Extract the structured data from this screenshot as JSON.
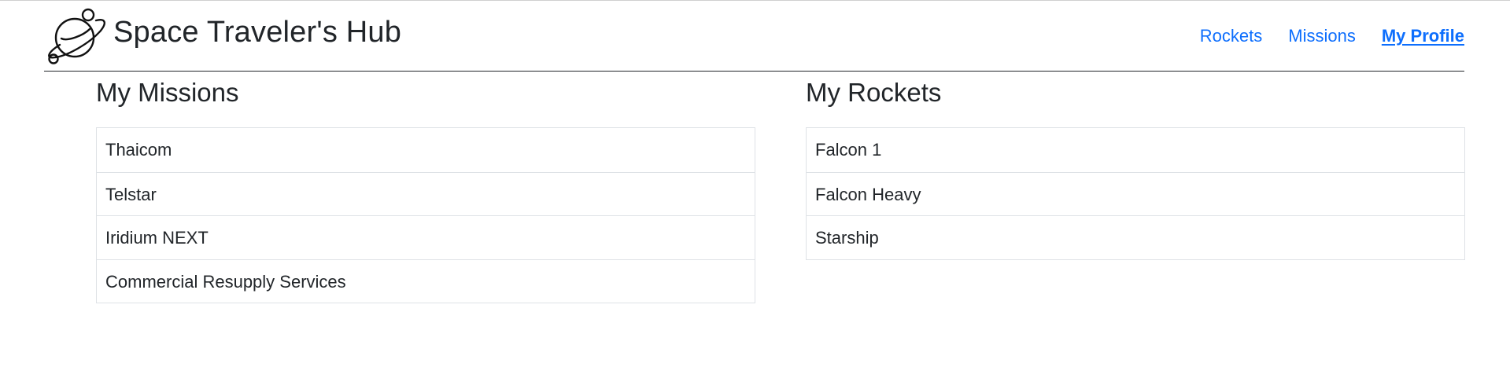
{
  "header": {
    "title": "Space Traveler's Hub",
    "logo_icon": "planet-icon",
    "nav": [
      {
        "label": "Rockets",
        "active": false
      },
      {
        "label": "Missions",
        "active": false
      },
      {
        "label": "My Profile",
        "active": true
      }
    ]
  },
  "missions": {
    "title": "My Missions",
    "items": [
      "Thaicom",
      "Telstar",
      "Iridium NEXT",
      "Commercial Resupply Services"
    ]
  },
  "rockets": {
    "title": "My Rockets",
    "items": [
      "Falcon 1",
      "Falcon Heavy",
      "Starship"
    ]
  },
  "colors": {
    "link": "#0d6efd",
    "text": "#212529",
    "border": "#dee2e6"
  }
}
